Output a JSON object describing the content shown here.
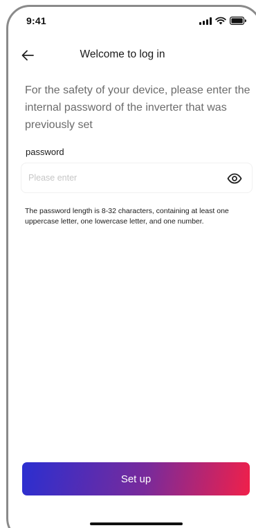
{
  "status_bar": {
    "time": "9:41"
  },
  "header": {
    "back_icon": "arrow-left-icon",
    "title": "Welcome to log in"
  },
  "intro": {
    "text": "For the safety of your device, please enter the internal password of the inverter that was previously set"
  },
  "password_field": {
    "label": "password",
    "value": "",
    "placeholder": "Please enter",
    "toggle_icon": "eye-icon"
  },
  "hint": {
    "text": "The password length is 8-32 characters, containing at least one uppercase letter, one lowercase letter, and one number."
  },
  "actions": {
    "setup_label": "Set up"
  },
  "colors": {
    "gradient_start": "#2b2fd0",
    "gradient_mid": "#7a2a9a",
    "gradient_end": "#f0204a",
    "placeholder": "#c6c6c6",
    "intro_text": "#6b6b6b"
  }
}
